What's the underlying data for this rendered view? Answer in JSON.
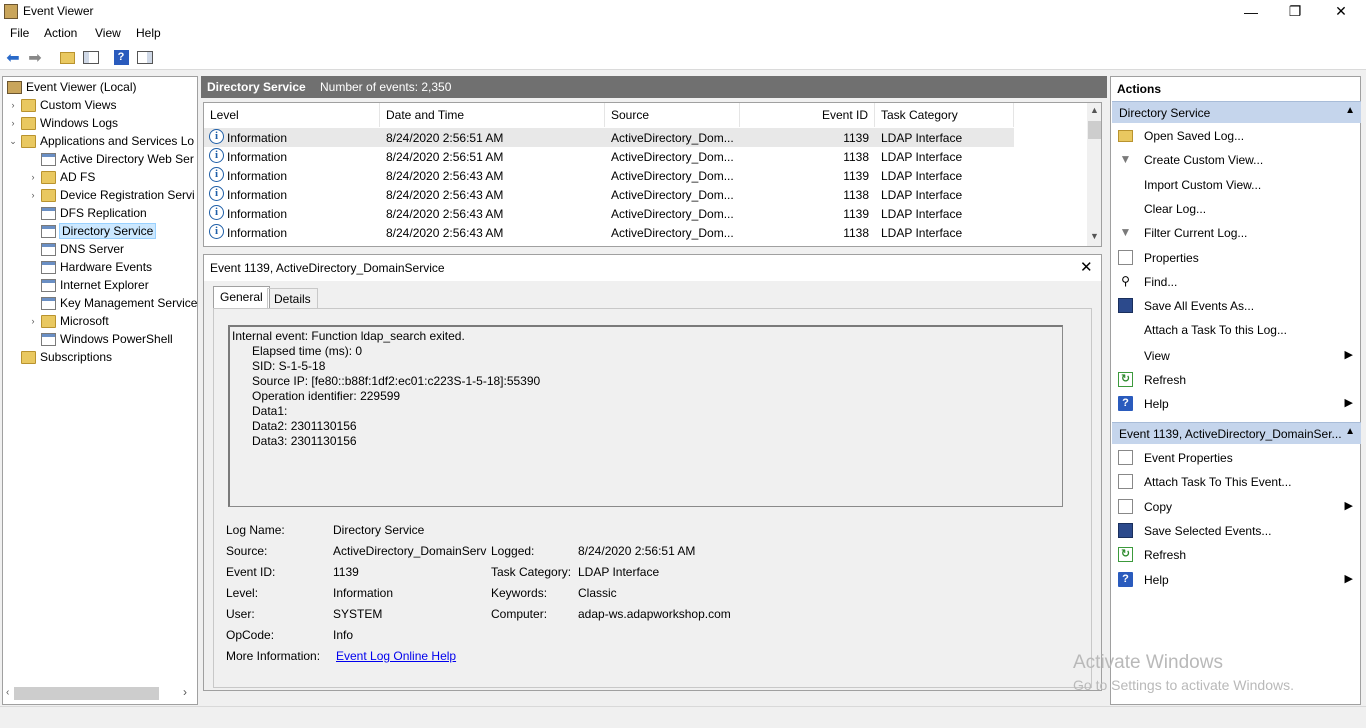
{
  "window": {
    "title": "Event Viewer",
    "controls": {
      "minimize": "—",
      "restore": "❐",
      "close": "✕"
    }
  },
  "menu": [
    "File",
    "Action",
    "View",
    "Help"
  ],
  "toolbar": {
    "icons": [
      "back-icon",
      "forward-icon",
      "up-folder-icon",
      "show-hide-tree-icon",
      "help-icon",
      "show-hide-action-pane-icon"
    ]
  },
  "tree": {
    "root": "Event Viewer (Local)",
    "items": [
      {
        "label": "Custom Views",
        "level": 1,
        "expander": "›",
        "icon": "folder"
      },
      {
        "label": "Windows Logs",
        "level": 1,
        "expander": "›",
        "icon": "folder"
      },
      {
        "label": "Applications and Services Lo",
        "level": 1,
        "expander": "⌄",
        "icon": "folder"
      },
      {
        "label": "Active Directory Web Ser",
        "level": 2,
        "expander": "",
        "icon": "log"
      },
      {
        "label": "AD FS",
        "level": 2,
        "expander": "›",
        "icon": "folder"
      },
      {
        "label": "Device Registration Servi",
        "level": 2,
        "expander": "›",
        "icon": "folder"
      },
      {
        "label": "DFS Replication",
        "level": 2,
        "expander": "",
        "icon": "log"
      },
      {
        "label": "Directory Service",
        "level": 2,
        "expander": "",
        "icon": "log",
        "selected": true
      },
      {
        "label": "DNS Server",
        "level": 2,
        "expander": "",
        "icon": "log"
      },
      {
        "label": "Hardware Events",
        "level": 2,
        "expander": "",
        "icon": "log"
      },
      {
        "label": "Internet Explorer",
        "level": 2,
        "expander": "",
        "icon": "log"
      },
      {
        "label": "Key Management Service",
        "level": 2,
        "expander": "",
        "icon": "log"
      },
      {
        "label": "Microsoft",
        "level": 2,
        "expander": "›",
        "icon": "folder"
      },
      {
        "label": "Windows PowerShell",
        "level": 2,
        "expander": "",
        "icon": "log"
      },
      {
        "label": "Subscriptions",
        "level": 1,
        "expander": "",
        "icon": "folder"
      }
    ]
  },
  "center": {
    "title": "Directory Service",
    "count": "Number of events: 2,350"
  },
  "events": {
    "columns": [
      "Level",
      "Date and Time",
      "Source",
      "Event ID",
      "Task Category"
    ],
    "rows": [
      {
        "level": "Information",
        "datetime": "8/24/2020 2:56:51 AM",
        "source": "ActiveDirectory_Dom...",
        "event_id": "1139",
        "category": "LDAP Interface",
        "selected": true
      },
      {
        "level": "Information",
        "datetime": "8/24/2020 2:56:51 AM",
        "source": "ActiveDirectory_Dom...",
        "event_id": "1138",
        "category": "LDAP Interface"
      },
      {
        "level": "Information",
        "datetime": "8/24/2020 2:56:43 AM",
        "source": "ActiveDirectory_Dom...",
        "event_id": "1139",
        "category": "LDAP Interface"
      },
      {
        "level": "Information",
        "datetime": "8/24/2020 2:56:43 AM",
        "source": "ActiveDirectory_Dom...",
        "event_id": "1138",
        "category": "LDAP Interface"
      },
      {
        "level": "Information",
        "datetime": "8/24/2020 2:56:43 AM",
        "source": "ActiveDirectory_Dom...",
        "event_id": "1139",
        "category": "LDAP Interface"
      },
      {
        "level": "Information",
        "datetime": "8/24/2020 2:56:43 AM",
        "source": "ActiveDirectory_Dom...",
        "event_id": "1138",
        "category": "LDAP Interface"
      }
    ]
  },
  "detail": {
    "title": "Event 1139, ActiveDirectory_DomainService",
    "close": "✕",
    "tabs": [
      "General",
      "Details"
    ],
    "message": [
      "Internal event: Function ldap_search exited.",
      "      Elapsed time (ms): 0",
      "      SID: S-1-5-18",
      "      Source IP: [fe80::b88f:1df2:ec01:c223S-1-5-18]:55390",
      "      Operation identifier: 229599",
      "      Data1:",
      "      Data2: 2301130156",
      "      Data3: 2301130156"
    ],
    "fields": {
      "log_name_label": "Log Name:",
      "log_name": "Directory Service",
      "source_label": "Source:",
      "source": "ActiveDirectory_DomainServ",
      "logged_label": "Logged:",
      "logged": "8/24/2020 2:56:51 AM",
      "event_id_label": "Event ID:",
      "event_id": "1139",
      "task_category_label": "Task Category:",
      "task_category": "LDAP Interface",
      "level_label": "Level:",
      "level": "Information",
      "keywords_label": "Keywords:",
      "keywords": "Classic",
      "user_label": "User:",
      "user": "SYSTEM",
      "computer_label": "Computer:",
      "computer": "adap-ws.adapworkshop.com",
      "opcode_label": "OpCode:",
      "opcode": "Info",
      "more_info_label": "More Information:",
      "more_info_link": "Event Log Online Help"
    }
  },
  "actions": {
    "title": "Actions",
    "section1": "Directory Service",
    "section1_items": [
      {
        "label": "Open Saved Log...",
        "icon": "open-folder-icon",
        "arrow": ""
      },
      {
        "label": "Create Custom View...",
        "icon": "filter-icon",
        "arrow": ""
      },
      {
        "label": "Import Custom View...",
        "icon": "",
        "arrow": ""
      },
      {
        "label": "Clear Log...",
        "icon": "",
        "arrow": ""
      },
      {
        "label": "Filter Current Log...",
        "icon": "filter-icon",
        "arrow": ""
      },
      {
        "label": "Properties",
        "icon": "properties-icon",
        "arrow": ""
      },
      {
        "label": "Find...",
        "icon": "find-icon",
        "arrow": ""
      },
      {
        "label": "Save All Events As...",
        "icon": "save-icon",
        "arrow": ""
      },
      {
        "label": "Attach a Task To this Log...",
        "icon": "",
        "arrow": ""
      },
      {
        "label": "View",
        "icon": "",
        "arrow": "▶"
      },
      {
        "label": "Refresh",
        "icon": "refresh-icon",
        "arrow": ""
      },
      {
        "label": "Help",
        "icon": "help-icon",
        "arrow": "▶"
      }
    ],
    "section2": "Event 1139, ActiveDirectory_DomainSer...",
    "section2_items": [
      {
        "label": "Event Properties",
        "icon": "properties-icon",
        "arrow": ""
      },
      {
        "label": "Attach Task To This Event...",
        "icon": "task-icon",
        "arrow": ""
      },
      {
        "label": "Copy",
        "icon": "copy-icon",
        "arrow": "▶"
      },
      {
        "label": "Save Selected Events...",
        "icon": "save-icon",
        "arrow": ""
      },
      {
        "label": "Refresh",
        "icon": "refresh-icon",
        "arrow": ""
      },
      {
        "label": "Help",
        "icon": "help-icon",
        "arrow": "▶"
      }
    ]
  },
  "watermark": {
    "line1": "Activate Windows",
    "line2": "Go to Settings to activate Windows."
  }
}
